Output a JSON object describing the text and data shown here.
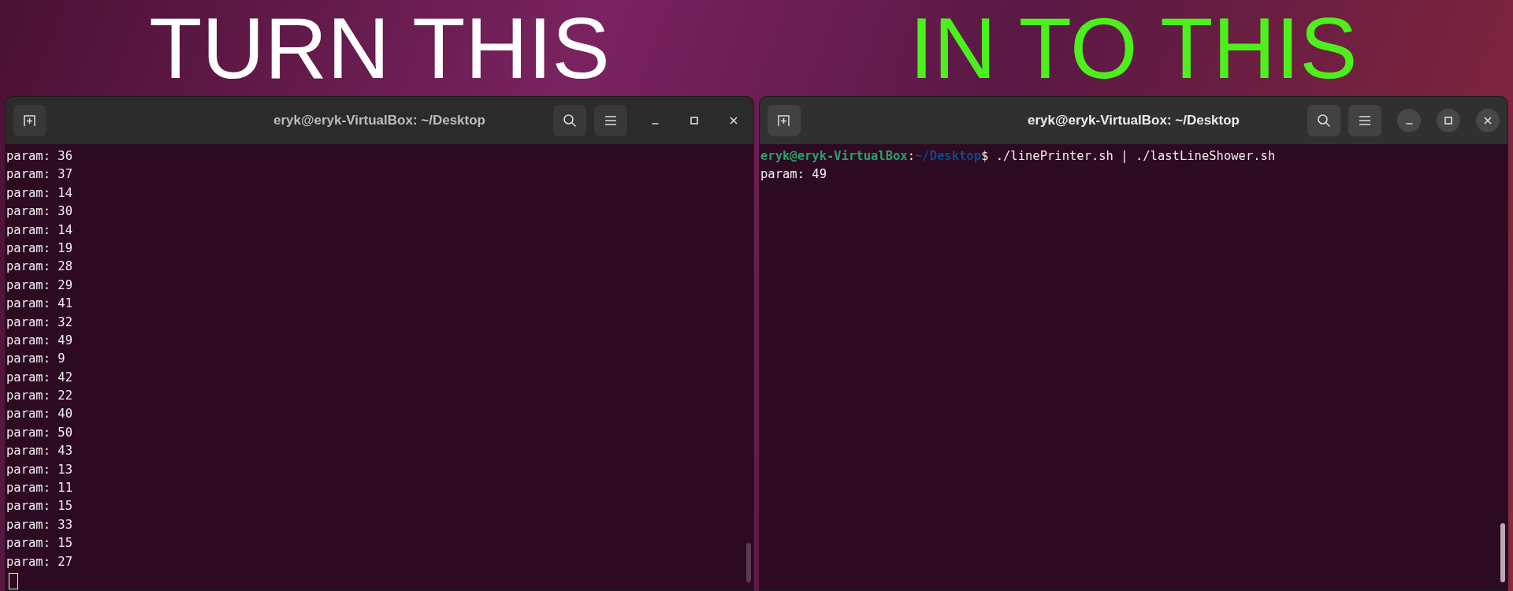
{
  "banner": [
    {
      "text": "TURN THIS",
      "color": "#ffffff"
    },
    {
      "text": "IN TO THIS",
      "color": "#4cf01c"
    }
  ],
  "windows": [
    {
      "title": "eryk@eryk-VirtualBox: ~/Desktop",
      "focused": false,
      "lines": [
        {
          "kind": "output",
          "text": "param: 36"
        },
        {
          "kind": "output",
          "text": "param: 37"
        },
        {
          "kind": "output",
          "text": "param: 14"
        },
        {
          "kind": "output",
          "text": "param: 30"
        },
        {
          "kind": "output",
          "text": "param: 14"
        },
        {
          "kind": "output",
          "text": "param: 19"
        },
        {
          "kind": "output",
          "text": "param: 28"
        },
        {
          "kind": "output",
          "text": "param: 29"
        },
        {
          "kind": "output",
          "text": "param: 41"
        },
        {
          "kind": "output",
          "text": "param: 32"
        },
        {
          "kind": "output",
          "text": "param: 49"
        },
        {
          "kind": "output",
          "text": "param: 9"
        },
        {
          "kind": "output",
          "text": "param: 42"
        },
        {
          "kind": "output",
          "text": "param: 22"
        },
        {
          "kind": "output",
          "text": "param: 40"
        },
        {
          "kind": "output",
          "text": "param: 50"
        },
        {
          "kind": "output",
          "text": "param: 43"
        },
        {
          "kind": "output",
          "text": "param: 13"
        },
        {
          "kind": "output",
          "text": "param: 11"
        },
        {
          "kind": "output",
          "text": "param: 15"
        },
        {
          "kind": "output",
          "text": "param: 33"
        },
        {
          "kind": "output",
          "text": "param: 15"
        },
        {
          "kind": "output",
          "text": "param: 27"
        },
        {
          "kind": "cursor"
        }
      ]
    },
    {
      "title": "eryk@eryk-VirtualBox: ~/Desktop",
      "focused": true,
      "lines": [
        {
          "kind": "prompt",
          "user_host": "eryk@eryk-VirtualBox",
          "separator": ":",
          "path": "~/Desktop",
          "command": "$ ./linePrinter.sh | ./lastLineShower.sh"
        },
        {
          "kind": "output",
          "text": "param: 49"
        }
      ]
    }
  ]
}
